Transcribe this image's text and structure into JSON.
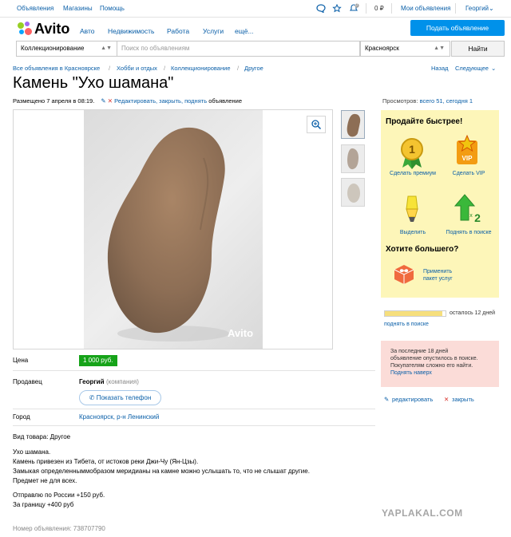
{
  "topbar": {
    "links": [
      "Объявления",
      "Магазины",
      "Помощь"
    ],
    "balance": "0 ₽",
    "notify_count": "0",
    "my_ads": "Мои объявления",
    "user": "Георгий"
  },
  "header": {
    "logo": "Avito",
    "nav": [
      "Авто",
      "Недвижимость",
      "Работа",
      "Услуги",
      "ещё..."
    ],
    "post_button": "Подать объявление"
  },
  "search": {
    "category": "Коллекционирование",
    "placeholder": "Поиск по объявлениям",
    "city": "Красноярск",
    "button": "Найти"
  },
  "breadcrumbs": [
    "Все объявления в Красноярске",
    "Хобби и отдых",
    "Коллекционирование",
    "Другое"
  ],
  "pager": {
    "back": "Назад",
    "next": "Следующее"
  },
  "listing": {
    "title": "Камень \"Ухо шамана\"",
    "posted": "Размещено 7 апреля в 08:19.",
    "edit_links": "Редактировать, закрыть, поднять",
    "edit_suffix": "объявление",
    "photo_watermark": "Avito"
  },
  "stats": {
    "label": "Просмотров:",
    "value": "всего 51, сегодня 1"
  },
  "promo": {
    "title": "Продайте быстрее!",
    "items": [
      {
        "label": "Сделать премиум",
        "icon": "premium-medal-icon"
      },
      {
        "label": "Сделать VIP",
        "icon": "vip-star-icon"
      },
      {
        "label": "Выделить",
        "icon": "highlighter-icon"
      },
      {
        "label": "Поднять в поиске",
        "icon": "raise-arrow-icon"
      }
    ],
    "more_title": "Хотите большего?",
    "bundle_line1": "Применить",
    "bundle_line2": "пакет услуг"
  },
  "expiry": {
    "remaining": "осталось 12 дней",
    "raise": "поднять в поиске",
    "progress": 0.95
  },
  "warning": {
    "line1": "За последние 18 дней",
    "line2": "объявление опустилось в поиске.",
    "line3": "Покупателям сложно его найти.",
    "link": "Поднять наверх"
  },
  "actions": {
    "edit": "редактировать",
    "close": "закрыть"
  },
  "details": {
    "price_label": "Цена",
    "price": "1 000 руб.",
    "seller_label": "Продавец",
    "seller_name": "Георгий",
    "seller_type": "(компания)",
    "phone_button": "Показать телефон",
    "city_label": "Город",
    "city": "Красноярск, р-н Ленинский"
  },
  "description": {
    "kind": "Вид товара: Другое",
    "lines": [
      "Ухо шамана.",
      "Камень привезен из Тибета, от истоков реки Джи-Чу (Ян-Цзы).",
      "Замыкая определенныммобразом меридианы на камне можно услышать то, что не слышат другие.",
      "Предмет не для всех."
    ],
    "shipping": [
      "Отправлю по России +150 руб.",
      "За границу +400 руб"
    ],
    "ad_number": "Номер объявления: 738707790"
  },
  "watermark_site": "YAPLAKAL.COM",
  "colors": {
    "accent_blue": "#0091ea",
    "price_green": "#16a319",
    "promo_bg": "#fdf6b9",
    "warning_bg": "#fbdcd8"
  }
}
